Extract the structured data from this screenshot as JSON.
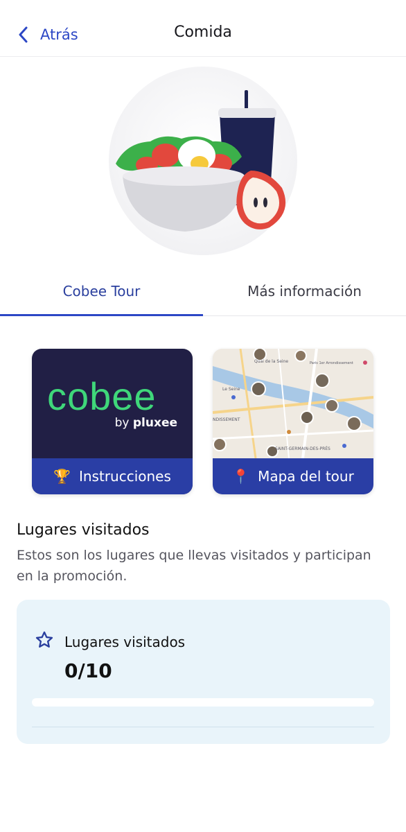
{
  "header": {
    "back_label": "Atrás",
    "title": "Comida"
  },
  "hero": {
    "image": "salad-bowl-drink-apple-illustration"
  },
  "tabs": [
    {
      "label": "Cobee Tour",
      "active": true
    },
    {
      "label": "Más información",
      "active": false
    }
  ],
  "cards": [
    {
      "label": "Instrucciones",
      "icon": "🏆",
      "logo_text": "cobee",
      "logo_sub_prefix": "by",
      "logo_sub_brand": "pluxee"
    },
    {
      "label": "Mapa del tour",
      "icon": "📍",
      "map_labels": [
        "Quai de la Seine",
        "Paris 1er Arrondissement",
        "SAINT-GERMAIN-DES-PRÉS",
        "NDISSEMENT",
        "Le Seine"
      ]
    }
  ],
  "section": {
    "title": "Lugares visitados",
    "description": "Estos son los lugares que llevas visitados y participan en la promoción."
  },
  "progress": {
    "label": "Lugares visitados",
    "count": "0/10",
    "fraction": 0
  },
  "colors": {
    "accent": "#2c47c5",
    "card_footer": "#2a3ea5",
    "logo_green": "#3fd77a",
    "progress_bg": "#e9f4fa"
  }
}
